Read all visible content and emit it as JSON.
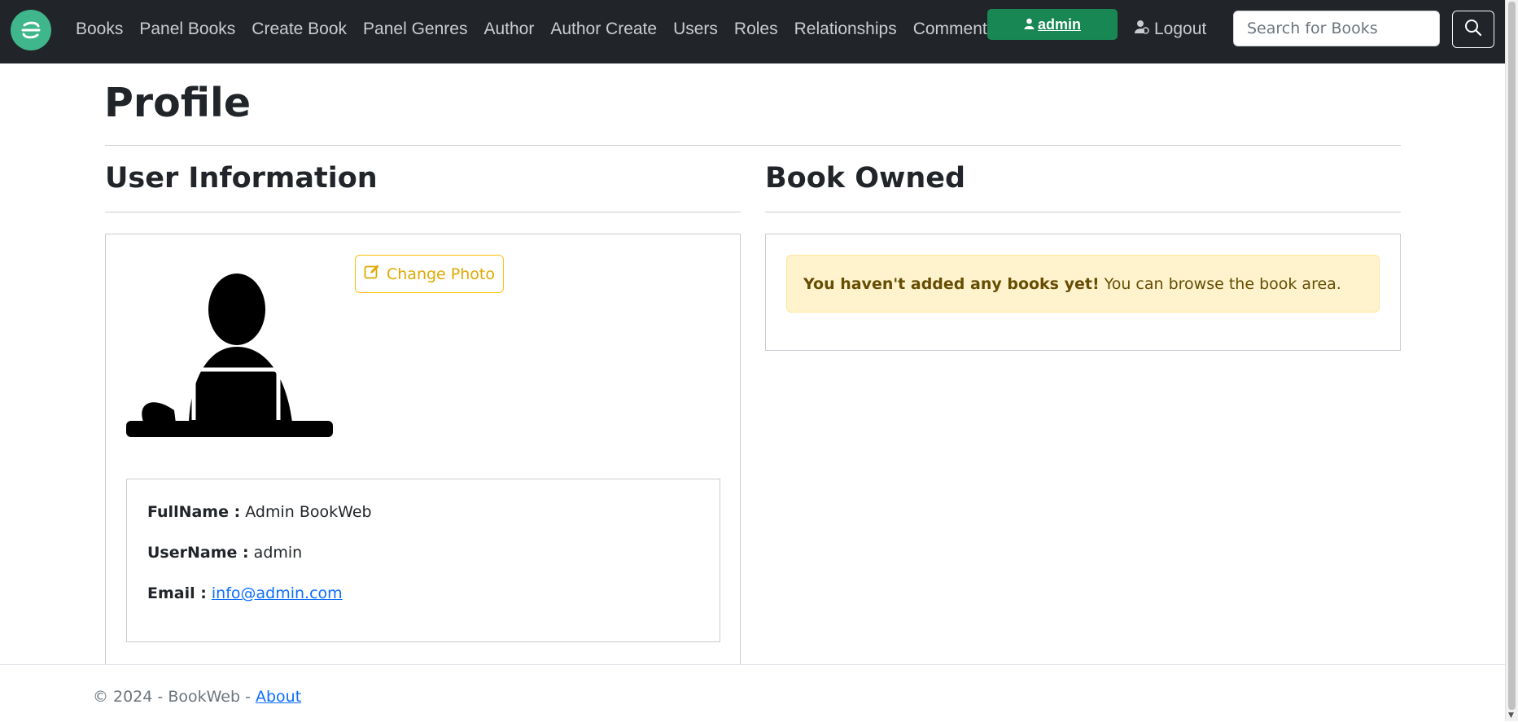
{
  "nav": {
    "brand_icon": "bookweb-logo-icon",
    "links": [
      {
        "label": "Books"
      },
      {
        "label": "Panel Books"
      },
      {
        "label": "Create Book"
      },
      {
        "label": "Panel Genres"
      },
      {
        "label": "Author"
      },
      {
        "label": "Author Create"
      },
      {
        "label": "Users"
      },
      {
        "label": "Roles"
      },
      {
        "label": "Relationships"
      },
      {
        "label": "Comments"
      }
    ],
    "user_button": "admin",
    "logout_label": "Logout",
    "search_placeholder": "Search for Books",
    "search_value": ""
  },
  "page": {
    "title": "Profile"
  },
  "user_info": {
    "heading": "User Information",
    "change_photo_label": "Change Photo",
    "fullname_label": "FullName :",
    "fullname_value": "Admin BookWeb",
    "username_label": "UserName :",
    "username_value": "admin",
    "email_label": "Email :",
    "email_value": "info@admin.com"
  },
  "books": {
    "heading": "Book Owned",
    "alert_strong": "You haven't added any books yet!",
    "alert_text": "You can browse the book area."
  },
  "footer": {
    "copyright": "© 2024 - BookWeb -",
    "about_label": "About"
  },
  "colors": {
    "navbar_bg": "#212529",
    "brand": "#3fb68b",
    "admin_button": "#198754",
    "warning": "#ffc107",
    "alert_bg": "#fff3cd",
    "link": "#0d6efd"
  }
}
